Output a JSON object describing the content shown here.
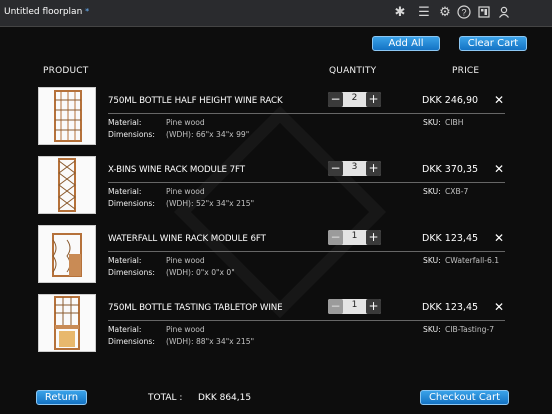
{
  "toolbar": {
    "title": "Untitled floorplan",
    "modified_marker": "*",
    "icons": [
      "snowflake-icon",
      "list-icon",
      "gear-icon",
      "help-icon",
      "catalog-icon",
      "user-icon"
    ]
  },
  "actions": {
    "add_all": "Add All",
    "clear_cart": "Clear Cart",
    "return": "Return",
    "checkout": "Checkout Cart"
  },
  "columns": {
    "product": "PRODUCT",
    "quantity": "QUANTITY",
    "price": "PRICE"
  },
  "labels": {
    "material": "Material:",
    "dimensions": "Dimensions:",
    "sku": "SKU:",
    "total": "TOTAL :"
  },
  "items": [
    {
      "name": "750ML BOTTLE HALF HEIGHT WINE RACK",
      "qty": "2",
      "price": "DKK 246,90",
      "material": "Pine wood",
      "dimensions": "(WDH): 66\"x 34\"x 99\"",
      "sku": "CIBH",
      "remove": "✕"
    },
    {
      "name": "X-BINS WINE RACK MODULE 7FT",
      "qty": "3",
      "price": "DKK 370,35",
      "material": "Pine wood",
      "dimensions": "(WDH): 52\"x 34\"x 215\"",
      "sku": "CXB-7",
      "remove": "✕"
    },
    {
      "name": "WATERFALL WINE RACK MODULE 6FT",
      "qty": "1",
      "price": "DKK 123,45",
      "material": "Pine wood",
      "dimensions": "(WDH): 0\"x 0\"x 0\"",
      "sku": "CWaterfall-6.1",
      "remove": "✕"
    },
    {
      "name": "750ML BOTTLE TASTING TABLETOP WINE",
      "qty": "1",
      "price": "DKK 123,45",
      "material": "Pine wood",
      "dimensions": "(WDH): 88\"x 34\"x 215\"",
      "sku": "CIB-Tasting-7",
      "remove": "✕"
    }
  ],
  "summary": {
    "total": "DKK 864,15"
  }
}
